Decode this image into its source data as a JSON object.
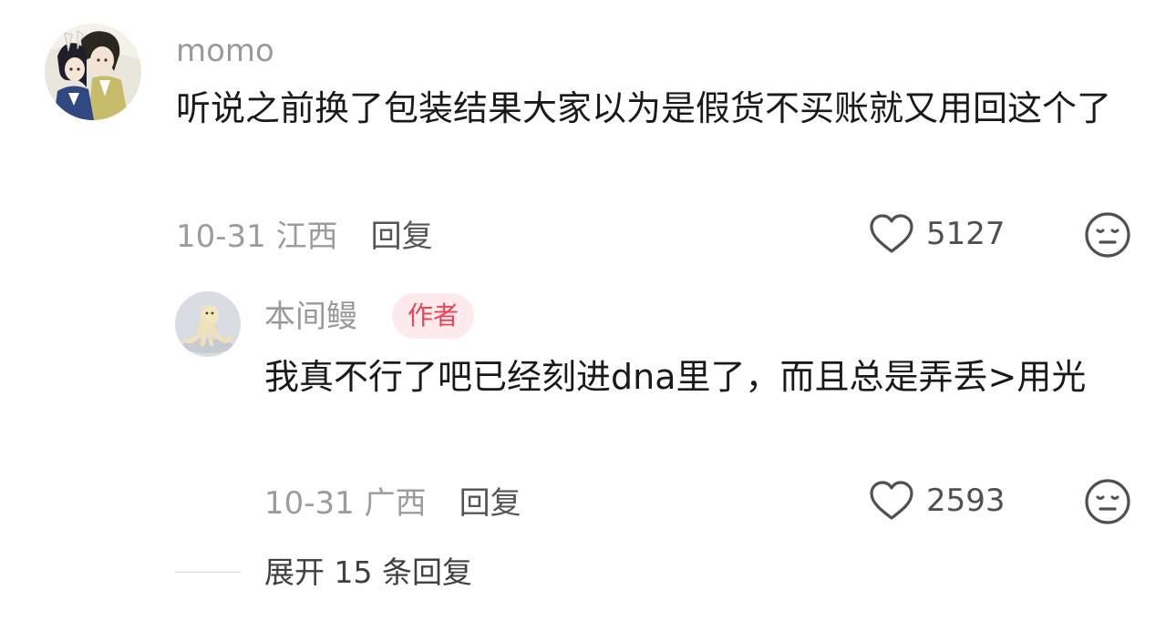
{
  "comment": {
    "username": "momo",
    "text": "听说之前换了包装结果大家以为是假货不买账就又用回这个了",
    "date_location": "10-31 江西",
    "reply_label": "回复",
    "like_count": "5127",
    "avatar_icon": "anime-couple-avatar",
    "like_icon": "heart-outline-icon",
    "dislike_icon": "meh-face-icon"
  },
  "reply": {
    "username": "本间鳗",
    "author_badge": "作者",
    "text": "我真不行了吧已经刻进dna里了，而且总是弄丢>用光",
    "date_location": "10-31 广西",
    "reply_label": "回复",
    "like_count": "2593",
    "avatar_icon": "cream-figure-avatar",
    "like_icon": "heart-outline-icon",
    "dislike_icon": "meh-face-icon"
  },
  "expand_replies_label": "展开 15 条回复",
  "colors": {
    "badge_bg": "#fdeaec",
    "badge_text": "#f04156",
    "muted_text": "#9c9c9c",
    "body_text": "#1a1a1a"
  }
}
